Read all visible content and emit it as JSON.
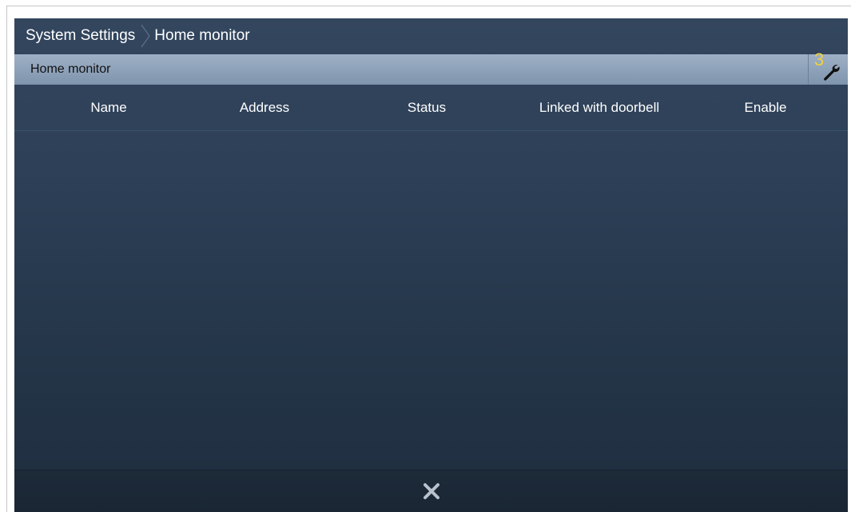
{
  "breadcrumb": {
    "items": [
      "System Settings",
      "Home monitor"
    ]
  },
  "panel": {
    "title": "Home monitor",
    "tool_badge": "3",
    "tool_icon": "wrench-icon"
  },
  "table": {
    "columns": [
      "Name",
      "Address",
      "Status",
      "Linked with doorbell",
      "Enable"
    ],
    "rows": []
  },
  "footer": {
    "close_icon": "close-icon"
  },
  "colors": {
    "background": "#2d4058",
    "header_bar": "#8ea3bb",
    "badge": "#f0d23c"
  }
}
